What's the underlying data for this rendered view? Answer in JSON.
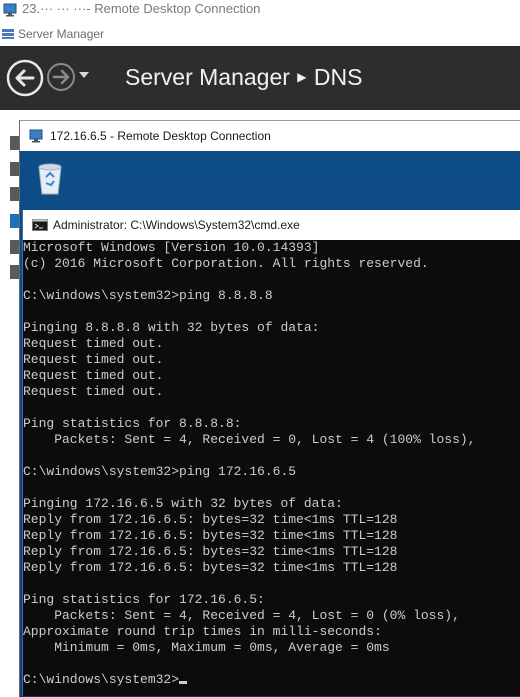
{
  "outer_window": {
    "title": "23.··· ··· ···- Remote Desktop Connection"
  },
  "server_manager": {
    "title": "Server Manager",
    "breadcrumb": {
      "root": "Server Manager",
      "separator": "▶",
      "current": "DNS"
    }
  },
  "inner_window": {
    "title": "172.16.6.5 - Remote Desktop Connection"
  },
  "cmd_window": {
    "title": "Administrator: C:\\Windows\\System32\\cmd.exe",
    "lines": [
      "Microsoft Windows [Version 10.0.14393]",
      "(c) 2016 Microsoft Corporation. All rights reserved.",
      "",
      "C:\\windows\\system32>ping 8.8.8.8",
      "",
      "Pinging 8.8.8.8 with 32 bytes of data:",
      "Request timed out.",
      "Request timed out.",
      "Request timed out.",
      "Request timed out.",
      "",
      "Ping statistics for 8.8.8.8:",
      "    Packets: Sent = 4, Received = 0, Lost = 4 (100% loss),",
      "",
      "C:\\windows\\system32>ping 172.16.6.5",
      "",
      "Pinging 172.16.6.5 with 32 bytes of data:",
      "Reply from 172.16.6.5: bytes=32 time<1ms TTL=128",
      "Reply from 172.16.6.5: bytes=32 time<1ms TTL=128",
      "Reply from 172.16.6.5: bytes=32 time<1ms TTL=128",
      "Reply from 172.16.6.5: bytes=32 time<1ms TTL=128",
      "",
      "Ping statistics for 172.16.6.5:",
      "    Packets: Sent = 4, Received = 4, Lost = 0 (0% loss),",
      "Approximate round trip times in milli-seconds:",
      "    Minimum = 0ms, Maximum = 0ms, Average = 0ms",
      ""
    ],
    "prompt": "C:\\windows\\system32>"
  },
  "colors": {
    "server_manager_header": "#2d2d2d",
    "console_background": "#0c0c0c",
    "console_text": "#cccccc",
    "desktop_background": "#0d4d86"
  },
  "icons": [
    "remote-desktop-icon",
    "server-manager-icon",
    "back-arrow-icon",
    "forward-arrow-icon",
    "dropdown-arrow-icon",
    "recycle-bin-icon",
    "cmd-icon"
  ]
}
